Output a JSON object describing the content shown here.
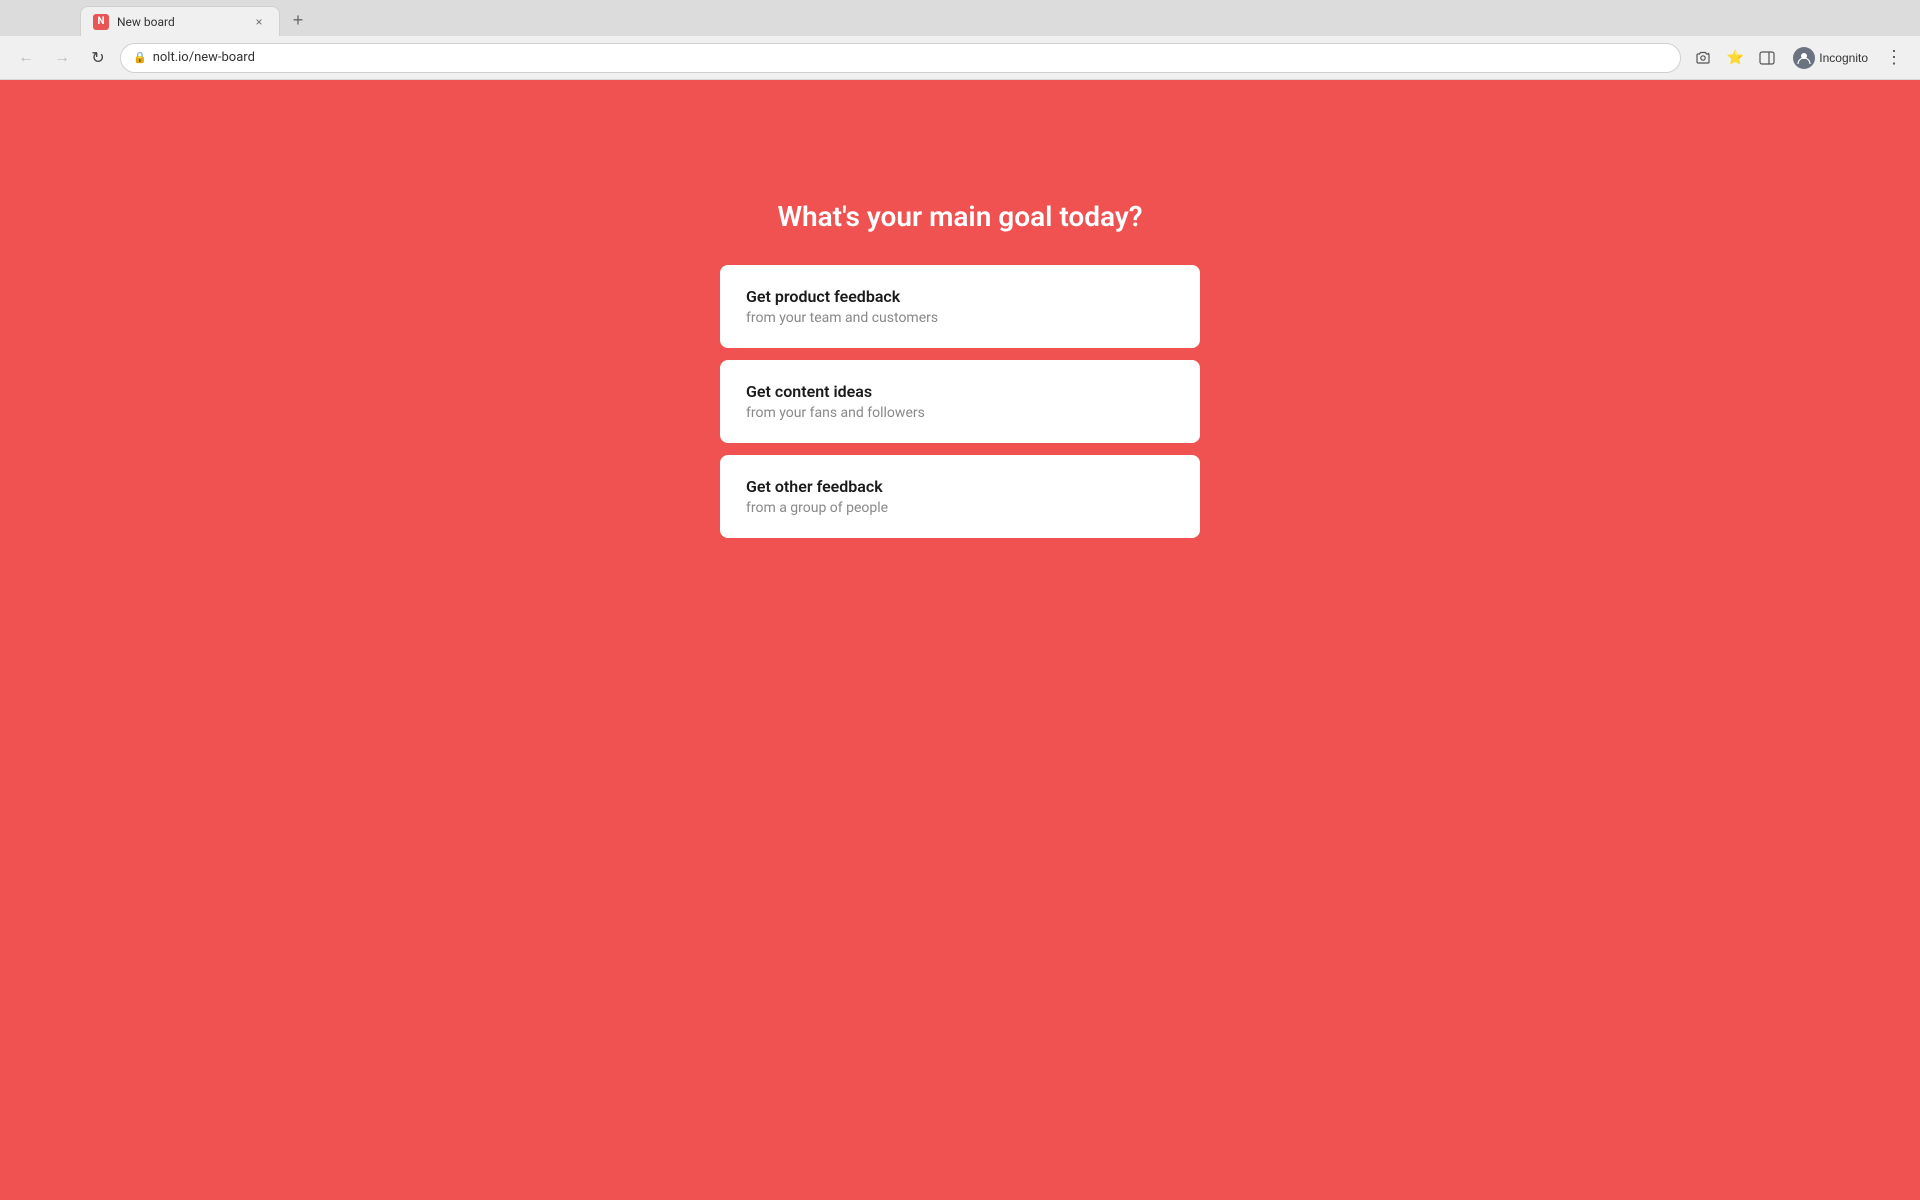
{
  "browser": {
    "tab_title": "New board",
    "tab_favicon_text": "N",
    "url": "nolt.io/new-board",
    "incognito_label": "Incognito",
    "nav": {
      "back_label": "←",
      "forward_label": "→",
      "reload_label": "↻"
    }
  },
  "page": {
    "heading": "What's your main goal today?",
    "background_color": "#f05252",
    "options": [
      {
        "id": "product-feedback",
        "title": "Get product feedback",
        "subtitle": "from your team and customers"
      },
      {
        "id": "content-ideas",
        "title": "Get content ideas",
        "subtitle": "from your fans and followers"
      },
      {
        "id": "other-feedback",
        "title": "Get other feedback",
        "subtitle": "from a group of people"
      }
    ]
  }
}
